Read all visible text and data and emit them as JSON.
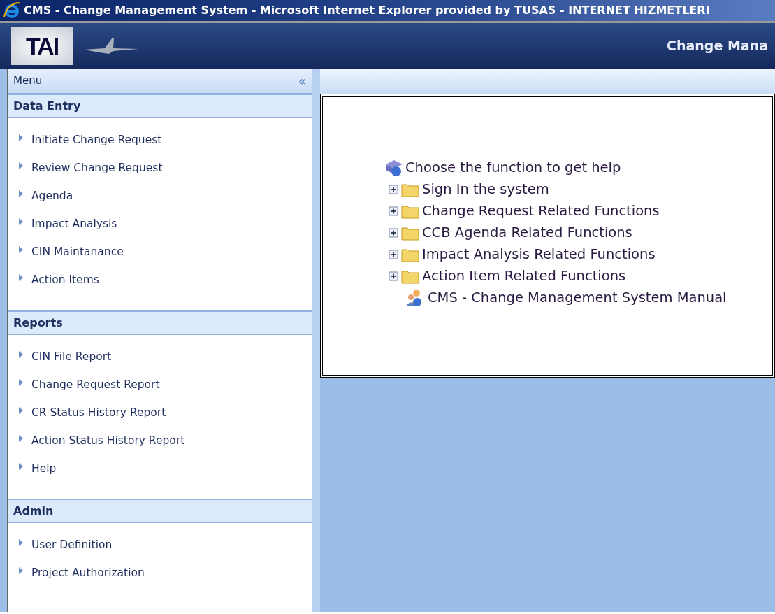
{
  "window": {
    "title": "CMS - Change Management System - Microsoft Internet Explorer provided by TUSAS - INTERNET HIZMETLERI"
  },
  "header": {
    "logo": "TAI",
    "title": "Change Mana"
  },
  "menu": {
    "title": "Menu",
    "collapse": "«",
    "sections": [
      {
        "title": "Data Entry",
        "items": [
          "Initiate Change Request",
          "Review Change Request",
          "Agenda",
          "Impact Analysis",
          "CIN Maintanance",
          "Action Items"
        ]
      },
      {
        "title": "Reports",
        "items": [
          "CIN File Report",
          "Change Request Report",
          "CR Status History Report",
          "Action Status History Report",
          "Help"
        ]
      },
      {
        "title": "Admin",
        "items": [
          "User Definition",
          "Project Authorization"
        ]
      }
    ]
  },
  "help": {
    "title": "Choose the function to get help",
    "entries": [
      {
        "kind": "folder",
        "label": "Sign In the system",
        "expanded": false
      },
      {
        "kind": "folder",
        "label": "Change Request Related Functions",
        "expanded": false
      },
      {
        "kind": "folder",
        "label": "CCB Agenda Related Functions",
        "expanded": false
      },
      {
        "kind": "folder",
        "label": "Impact Analysis Related Functions",
        "expanded": false
      },
      {
        "kind": "folder",
        "label": "Action Item Related Functions",
        "expanded": false
      },
      {
        "kind": "document",
        "label": "CMS - Change Management System Manual"
      }
    ]
  }
}
